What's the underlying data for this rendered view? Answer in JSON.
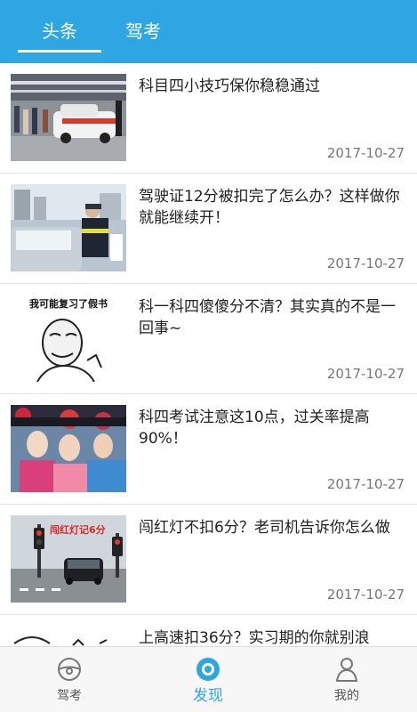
{
  "header": {
    "tabs": [
      {
        "label": "头条",
        "active": true
      },
      {
        "label": "驾考",
        "active": false
      }
    ],
    "accent_color": "#2ea6e4"
  },
  "articles": [
    {
      "title": "科目四小技巧保你稳稳通过",
      "date": "2017-10-27",
      "thumb_icon": "driving-test-photo"
    },
    {
      "title": "驾驶证12分被扣完了怎么办？这样做你就能继续开！",
      "date": "2017-10-27",
      "thumb_icon": "traffic-police-photo"
    },
    {
      "title": "科一科四傻傻分不清？其实真的不是一回事~",
      "date": "2017-10-27",
      "thumb_icon": "meme-face-image",
      "thumb_text": "我可能复习了假书"
    },
    {
      "title": "科四考试注意这10点，过关率提高90%！",
      "date": "2017-10-27",
      "thumb_icon": "costume-drama-photo"
    },
    {
      "title": "闯红灯不扣6分？老司机告诉你怎么做",
      "date": "2017-10-27",
      "thumb_icon": "traffic-light-photo",
      "thumb_text": "闯红灯记6分"
    },
    {
      "title": "上高速扣36分？实习期的你就别浪",
      "date": "",
      "thumb_icon": "sketch-image"
    }
  ],
  "bottom_nav": {
    "items": [
      {
        "label": "驾考",
        "icon": "steering-wheel-icon",
        "active": false
      },
      {
        "label": "发现",
        "icon": "discover-icon",
        "active": true
      },
      {
        "label": "我的",
        "icon": "user-icon",
        "active": false
      }
    ]
  }
}
